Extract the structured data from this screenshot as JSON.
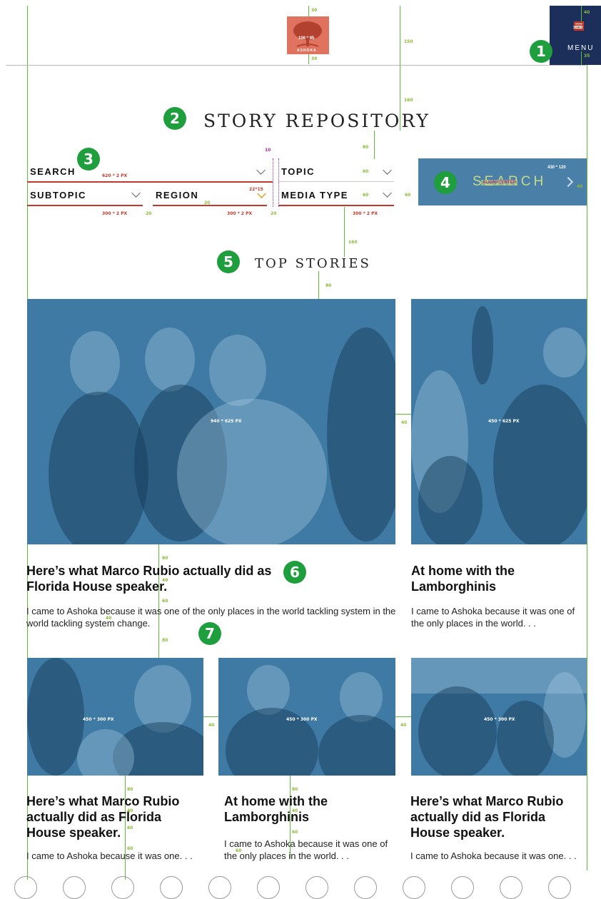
{
  "logo": {
    "text": "ASHOKA",
    "size_label": "106 * 95"
  },
  "menu": {
    "label": "MENU",
    "icon_size_label": "30*30"
  },
  "page_title": "STORY REPOSITORY",
  "filters": {
    "search_label": "SEARCH",
    "topic_label": "TOPIC",
    "subtopic_label": "SUBTOPIC",
    "region_label": "REGION",
    "media_type_label": "MEDIA TYPE"
  },
  "search_button": {
    "label": "SEARCH",
    "size_label": "430 * 120",
    "align_note": "ALIGN=CENTER"
  },
  "section_title": "TOP STORIES",
  "dims": {
    "d30a": "30",
    "d30b": "30",
    "d150": "150",
    "d160a": "160",
    "d40a": "40",
    "d35": "35",
    "d10": "10",
    "d80a": "80",
    "d60a": "60",
    "d60b": "60",
    "d60c": "60",
    "d40b": "40",
    "search_underline": "620 * 2 PX",
    "icon_size": "22*15",
    "d20a": "20",
    "d20b": "20",
    "d20c": "20",
    "sub_underline": "300 * 2 PX",
    "region_underline": "300 * 2 PX",
    "media_underline": "300 * 2 PX",
    "d160b": "160",
    "d80b": "80",
    "d40c": "40",
    "d80c": "80",
    "d40d": "40",
    "d60d": "60",
    "d80d": "80",
    "d40e": "40",
    "d40f": "40",
    "d40g": "40",
    "d80e": "80",
    "d40h": "40",
    "d60e": "60",
    "d60f": "60",
    "d80f": "80",
    "d40i": "40",
    "d60g": "60",
    "d60h": "60"
  },
  "featured": [
    {
      "image_label": "940 * 625 PX",
      "headline": "Here’s what Marco Rubio actually did as Florida House speaker.",
      "excerpt": "I came to Ashoka because it was one of the only places in the world tackling system in the world tackling system change."
    },
    {
      "image_label": "450 * 625 PX",
      "headline": "At home with the Lamborghinis",
      "excerpt": "I came to Ashoka because it was one of the only places in the world. . ."
    }
  ],
  "grid": [
    {
      "image_label": "450 * 300 PX",
      "headline": "Here’s what Marco Rubio actually did as Florida House speaker.",
      "excerpt": "I came to Ashoka because it was one. . ."
    },
    {
      "image_label": "450 * 300 PX",
      "headline": "At home with the Lamborghinis",
      "excerpt": "I came to Ashoka because it was one of the only places in the world. . ."
    },
    {
      "image_label": "450 * 300 PX",
      "headline": "Here’s what Marco Rubio actually did as Florida House speaker.",
      "excerpt": "I came to Ashoka because it was one. . ."
    }
  ],
  "annotations": [
    "1",
    "2",
    "3",
    "4",
    "5",
    "6",
    "7"
  ],
  "colors": {
    "brand_navy": "#1c2e5a",
    "search_blue": "#4a7fa8",
    "photo_tint": "#3f7aa5",
    "guide_green": "#5bbf3a",
    "underline_red": "#c0392b",
    "badge_green": "#1e9e3c"
  }
}
